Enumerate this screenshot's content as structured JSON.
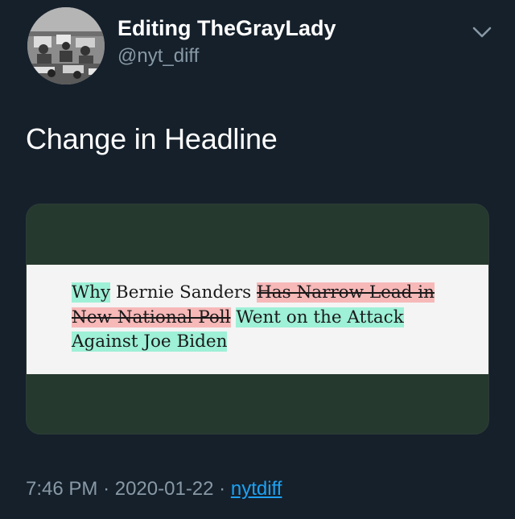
{
  "tweet": {
    "author": {
      "display_name": "Editing TheGrayLady",
      "handle": "@nyt_diff",
      "avatar_icon": "newsroom-photo-avatar"
    },
    "menu_icon": "chevron-down-icon",
    "text": "Change in Headline",
    "media": {
      "type": "headline-diff",
      "segments": [
        {
          "text": "Why",
          "change": "inserted"
        },
        {
          "text": " Bernie Sanders ",
          "change": "unchanged"
        },
        {
          "text": "Has Narrow Lead in New National Poll",
          "change": "deleted"
        },
        {
          "text": " ",
          "change": "unchanged"
        },
        {
          "text": "Went on the Attack Against Joe Biden",
          "change": "inserted"
        }
      ],
      "colors": {
        "inserted": "#9ef0d6",
        "deleted": "#f7b8b8",
        "card_background": "#26392f",
        "strip_background": "#f4f4f4"
      }
    },
    "footer": {
      "time": "7:46 PM",
      "separator": "·",
      "date": "2020-01-22",
      "source": "nytdiff"
    }
  },
  "theme": {
    "background": "#15202b",
    "text_primary": "#ffffff",
    "text_secondary": "#8899a6",
    "link": "#1da1f2"
  }
}
